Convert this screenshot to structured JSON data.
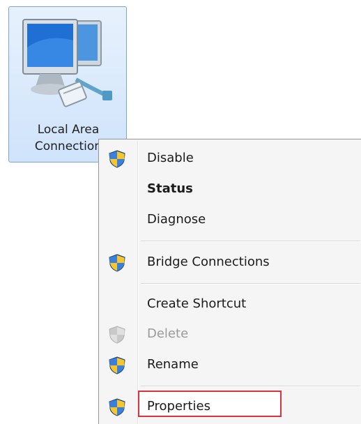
{
  "network_item": {
    "icon": "network-computers-icon",
    "label_line1": "Local Area",
    "label_line2": "Connection"
  },
  "context_menu": {
    "items": [
      {
        "label": "Disable",
        "icon": "uac-shield-icon",
        "style": "normal"
      },
      {
        "label": "Status",
        "icon": "",
        "style": "bold"
      },
      {
        "label": "Diagnose",
        "icon": "",
        "style": "normal"
      },
      {
        "label": "Bridge Connections",
        "icon": "uac-shield-icon",
        "style": "normal"
      },
      {
        "label": "Create Shortcut",
        "icon": "",
        "style": "normal"
      },
      {
        "label": "Delete",
        "icon": "uac-shield-icon",
        "style": "disabled"
      },
      {
        "label": "Rename",
        "icon": "uac-shield-icon",
        "style": "normal"
      },
      {
        "label": "Properties",
        "icon": "uac-shield-icon",
        "style": "highlighted"
      }
    ]
  },
  "colors": {
    "selection_border": "#7aa7d9",
    "highlight_border": "#d9343a",
    "menu_bg": "#f5f5f5"
  }
}
